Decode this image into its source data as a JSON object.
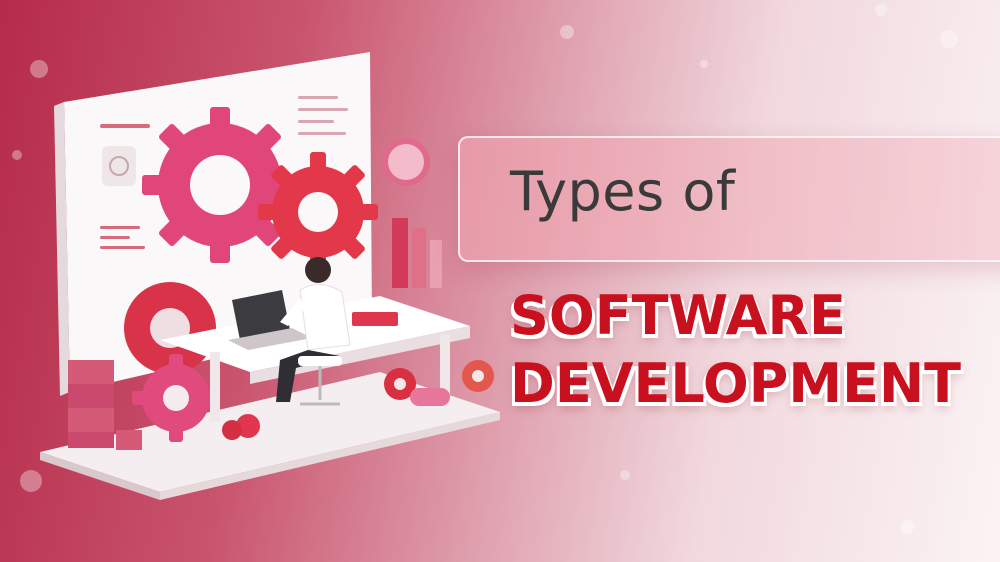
{
  "heading": {
    "subtitle": "Types of",
    "title_line1": "SOFTWARE",
    "title_line2": "DEVELOPMENT"
  },
  "colors": {
    "title_red": "#c9101e",
    "subtitle_gray": "#3a3a3a",
    "background_left": "#b52b49",
    "background_right": "#fbf3f4",
    "accent_pink": "#e6457a"
  },
  "illustration": {
    "icon": "developer-at-desk-with-gears-icon"
  }
}
